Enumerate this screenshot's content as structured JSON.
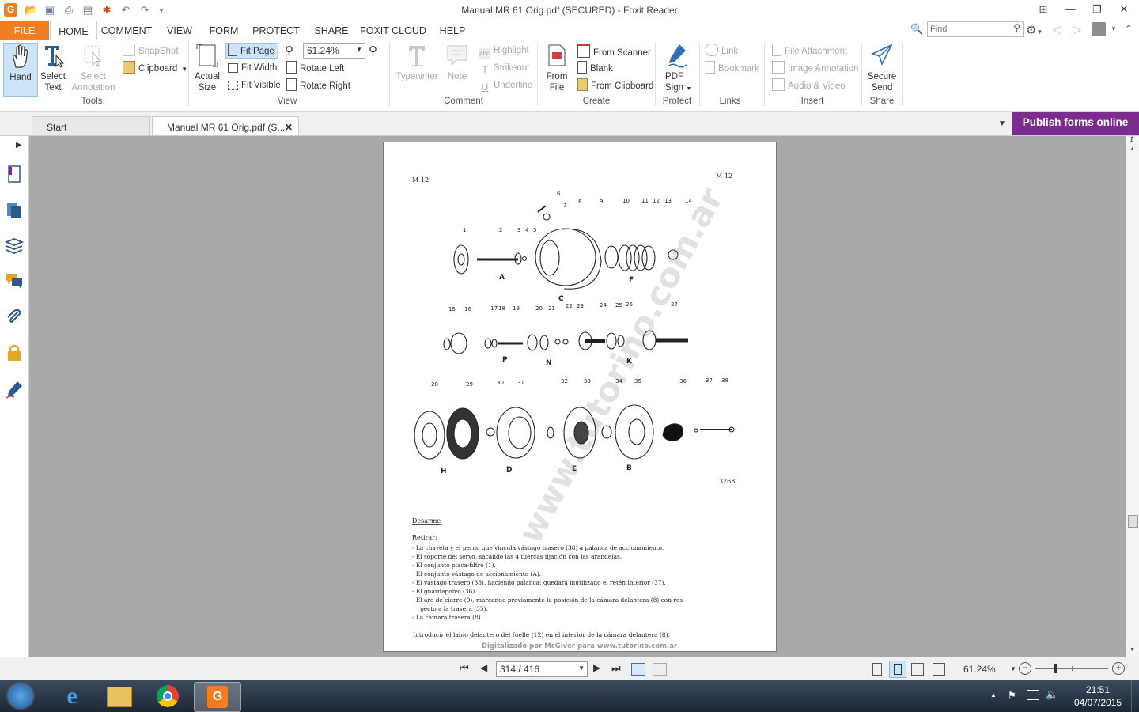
{
  "window": {
    "title": "Manual MR 61 Orig.pdf (SECURED) - Foxit Reader"
  },
  "ribbon_tabs": [
    "FILE",
    "HOME",
    "COMMENT",
    "VIEW",
    "FORM",
    "PROTECT",
    "SHARE",
    "FOXIT CLOUD",
    "HELP"
  ],
  "search": {
    "placeholder": "Find"
  },
  "tools": {
    "hand": "Hand",
    "select_text": "Select Text",
    "select_annotation": "Select Annotation",
    "snapshot": "SnapShot",
    "clipboard": "Clipboard",
    "group": "Tools"
  },
  "view": {
    "actual_size": "Actual Size",
    "fit_page": "Fit Page",
    "fit_width": "Fit Width",
    "fit_visible": "Fit Visible",
    "zoom_value": "61.24%",
    "rotate_left": "Rotate Left",
    "rotate_right": "Rotate Right",
    "group": "View"
  },
  "comment": {
    "typewriter": "Typewriter",
    "note": "Note",
    "highlight": "Highlight",
    "strikeout": "Strikeout",
    "underline": "Underline",
    "group": "Comment"
  },
  "create": {
    "from_file": "From File",
    "from_scanner": "From Scanner",
    "blank": "Blank",
    "from_clipboard": "From Clipboard",
    "group": "Create"
  },
  "protect": {
    "pdf_sign": "PDF Sign",
    "group": "Protect"
  },
  "links": {
    "link": "Link",
    "bookmark": "Bookmark",
    "group": "Links"
  },
  "insert": {
    "file_attachment": "File Attachment",
    "image_annotation": "Image Annotation",
    "audio_video": "Audio & Video",
    "group": "Insert"
  },
  "share": {
    "secure_send": "Secure Send",
    "group": "Share"
  },
  "doc_tabs": {
    "start": "Start",
    "current": "Manual MR 61 Orig.pdf (S..."
  },
  "publish_banner": "Publish forms online",
  "page": {
    "header_left": "M-12",
    "header_right": "M-12",
    "figure_number": "3268",
    "watermark": "www.tutorino.com.ar",
    "callouts_row1": [
      "1",
      "2",
      "3",
      "4",
      "5",
      "6",
      "7",
      "8",
      "9",
      "10",
      "11",
      "12",
      "13",
      "14"
    ],
    "callouts_row2": [
      "15",
      "16",
      "17",
      "18",
      "19",
      "20",
      "21",
      "22",
      "23",
      "24",
      "25",
      "26",
      "27"
    ],
    "callouts_row3": [
      "28",
      "29",
      "30",
      "31",
      "32",
      "33",
      "34",
      "35",
      "36",
      "37",
      "38"
    ],
    "group_letters": [
      "A",
      "C",
      "F",
      "P",
      "N",
      "K",
      "H",
      "D",
      "E",
      "B"
    ],
    "section_title": "Desarme",
    "intro": "Retirar:",
    "steps": [
      "- La chaveta y el perno que vincula vástago trasero (38) a palanca de accionamiento.",
      "- El soporte del servo, sacando las 4 tuercas fijación con las arandelas.",
      "- El conjunto placa-filtro (1).",
      "- El conjunto vástago de accionamiento (A).",
      "- El vástago trasero (38), haciendo palanca; quedará inutilizado el retén interior (37).",
      "- El guardapolvo (36).",
      "- El aro de cierre (9), marcando previamente la posición de la cámara delantera (8) con res",
      "pecto a la trasera (35).",
      "- La cámara trasera (8)."
    ],
    "closing": "Introducir el labio delantero del fuelle (12) en el interior de la cámara delantera (8).",
    "footer": "Digitalizado por McGiver para www.tutorino.com.ar"
  },
  "status": {
    "page_indicator": "314 / 416",
    "zoom": "61.24%"
  },
  "clock": {
    "time": "21:51",
    "date": "04/07/2015"
  }
}
